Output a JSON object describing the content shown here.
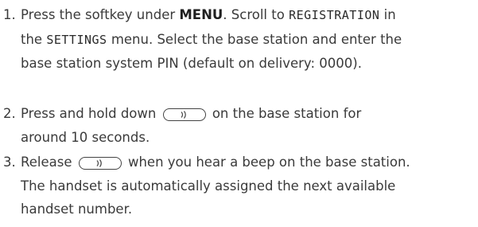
{
  "steps": [
    {
      "number": "1.",
      "text_a": "Press the softkey under ",
      "bold": "MENU",
      "text_b": ". Scroll to ",
      "lcd_a": "REGISTRATION",
      "text_c": " in",
      "text_d": "the ",
      "lcd_b": "SETTINGS",
      "text_e": " menu. Select the base station and enter the",
      "text_f": "base station system PIN (default on delivery: 0000)."
    },
    {
      "number": "2.",
      "text_a": "Press and hold down ",
      "text_b": " on the base station for",
      "text_c": "around 10 seconds."
    },
    {
      "number": "3.",
      "text_a": "Release ",
      "text_b": " when you hear a beep on the base station.",
      "text_c": "The handset is automatically assigned the next available",
      "text_d": "handset number."
    }
  ],
  "icons": {
    "paging_key": "paging-button-icon"
  }
}
